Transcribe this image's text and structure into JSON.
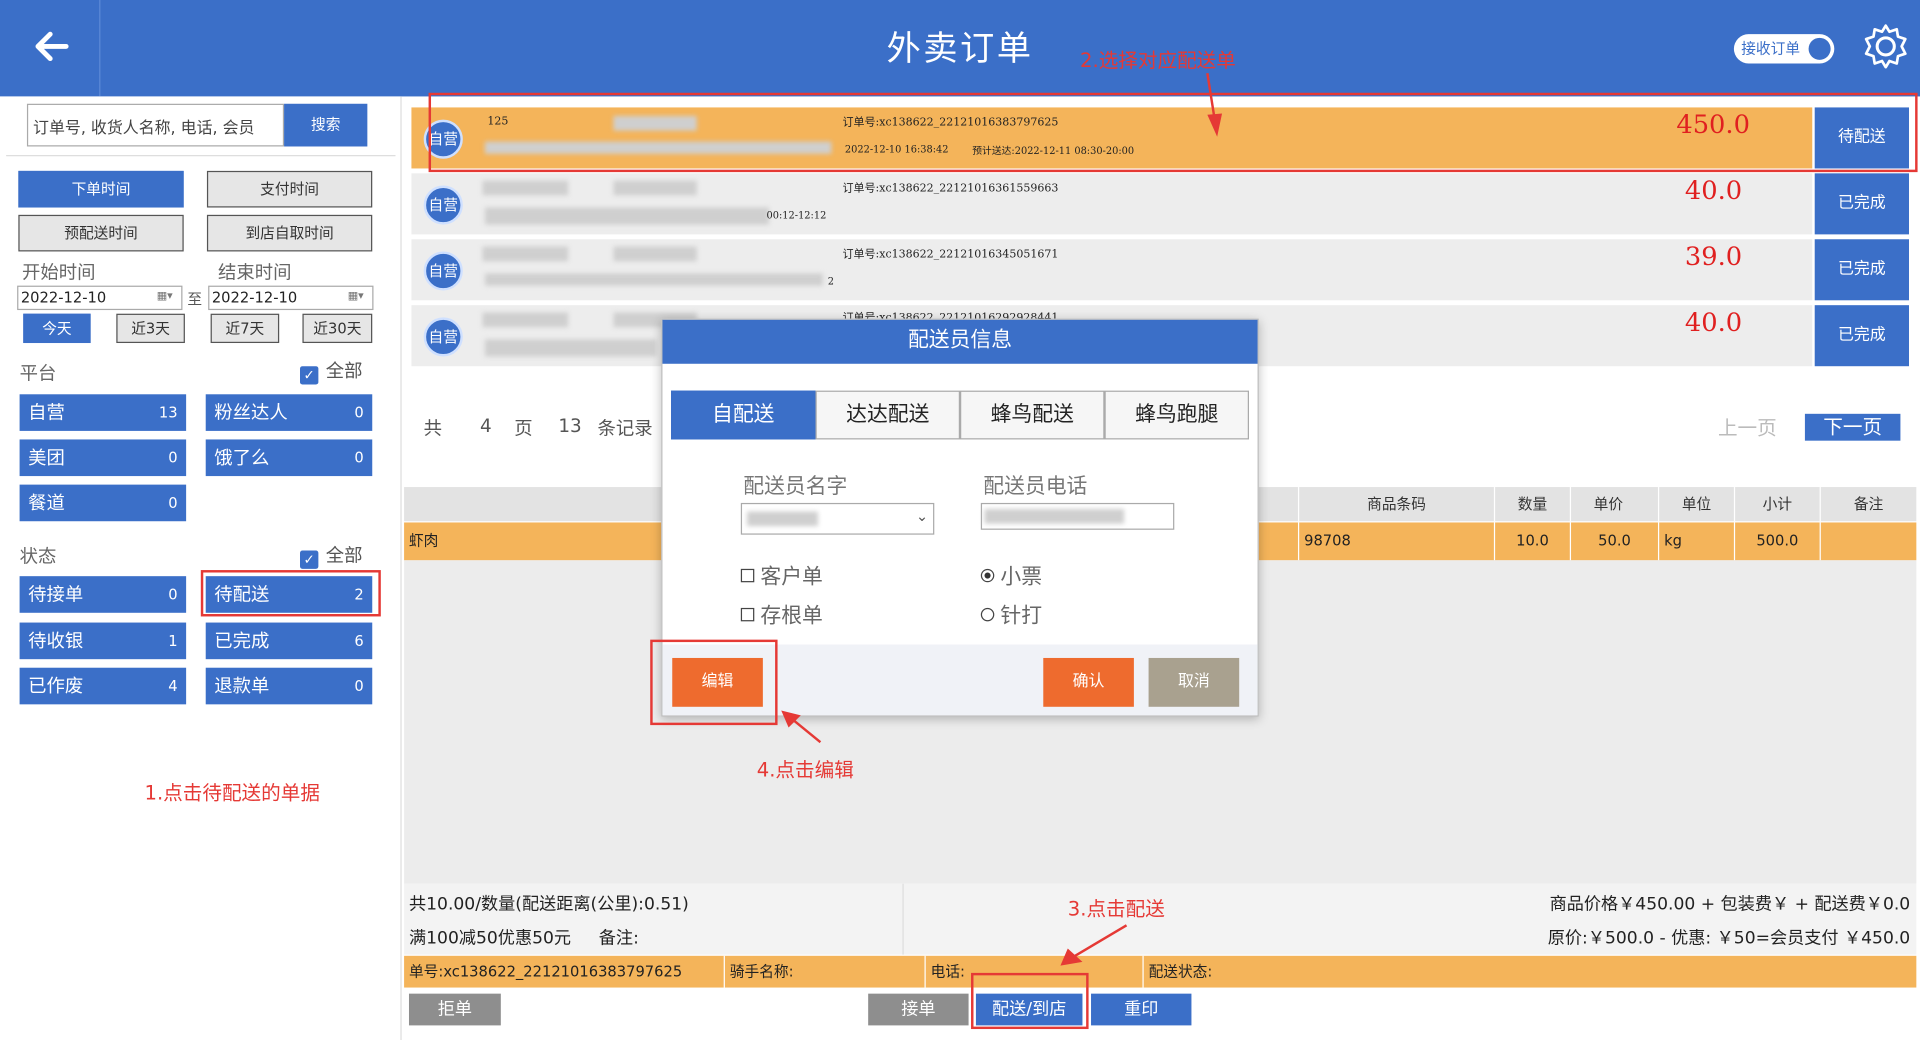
{
  "header": {
    "title": "外卖订单",
    "toggle_label": "接收订单"
  },
  "search": {
    "placeholder": "订单号, 收货人名称, 电话, 会员",
    "button": "搜索"
  },
  "time_filters": {
    "order_time": "下单时间",
    "pay_time": "支付时间",
    "pre_delivery_time": "预配送时间",
    "pickup_time": "到店自取时间"
  },
  "date_range": {
    "start_label": "开始时间",
    "end_label": "结束时间",
    "start": "2022-12-10",
    "end": "2022-12-10",
    "separator": "至",
    "quick": [
      "今天",
      "近3天",
      "近7天",
      "近30天"
    ]
  },
  "platform": {
    "label": "平台",
    "all_label": "全部",
    "items": [
      {
        "name": "自营",
        "count": "13"
      },
      {
        "name": "粉丝达人",
        "count": "0"
      },
      {
        "name": "美团",
        "count": "0"
      },
      {
        "name": "饿了么",
        "count": "0"
      },
      {
        "name": "餐道",
        "count": "0"
      }
    ]
  },
  "status": {
    "label": "状态",
    "all_label": "全部",
    "items": [
      {
        "name": "待接单",
        "count": "0"
      },
      {
        "name": "待配送",
        "count": "2"
      },
      {
        "name": "待收银",
        "count": "1"
      },
      {
        "name": "已完成",
        "count": "6"
      },
      {
        "name": "已作废",
        "count": "4"
      },
      {
        "name": "退款单",
        "count": "0"
      }
    ]
  },
  "orders": [
    {
      "badge": "自营",
      "code": "125",
      "order_no": "订单号:xc138622_22121016383797625",
      "time": "2022-12-10 16:38:42",
      "expected": "预计送达:2022-12-11 08:30-20:00",
      "amount": "450.0",
      "status": "待配送"
    },
    {
      "badge": "自营",
      "order_no": "订单号:xc138622_22121016361559663",
      "time_tail": "00:12-12:12",
      "amount": "40.0",
      "status": "已完成"
    },
    {
      "badge": "自营",
      "order_no": "订单号:xc138622_22121016345051671",
      "time_tail": "2",
      "amount": "39.0",
      "status": "已完成"
    },
    {
      "badge": "自营",
      "order_no": "订单号:xc138622_22121016292928441",
      "amount": "40.0",
      "status": "已完成"
    }
  ],
  "pager": {
    "total_prefix": "共",
    "pages": "4",
    "page_unit": "页",
    "records": "13",
    "record_unit": "条记录",
    "prev": "上一页",
    "next": "下一页"
  },
  "table": {
    "headers": [
      "商品条码",
      "数量",
      "单价",
      "单位",
      "小计",
      "备注"
    ],
    "rows": [
      {
        "name": "虾肉",
        "barcode": "98708",
        "qty": "10.0",
        "price": "50.0",
        "unit": "kg",
        "subtotal": "500.0",
        "note": ""
      }
    ]
  },
  "summary": {
    "left1": "共10.00/数量(配送距离(公里):0.51)",
    "left2": "满100减50优惠50元",
    "note_label": "备注:",
    "right1": "商品价格￥450.00 + 包装费￥ + 配送费￥0.0",
    "right2": "原价:￥500.0 - 优惠: ￥50=会员支付 ￥450.0"
  },
  "info_bar": {
    "order_no": "单号:xc138622_22121016383797625",
    "rider": "骑手名称:",
    "phone": "电话:",
    "delivery_status": "配送状态:"
  },
  "bottom_buttons": {
    "reject": "拒单",
    "accept": "接单",
    "deliver": "配送/到店",
    "reprint": "重印"
  },
  "modal": {
    "title": "配送员信息",
    "tabs": [
      "自配送",
      "达达配送",
      "蜂鸟配送",
      "蜂鸟跑腿"
    ],
    "name_label": "配送员名字",
    "phone_label": "配送员电话",
    "options": {
      "customer": "客户单",
      "stub": "存根单",
      "receipt": "小票",
      "dot": "针打"
    },
    "edit": "编辑",
    "confirm": "确认",
    "cancel": "取消"
  },
  "annotations": {
    "step1": "1.点击待配送的单据",
    "step2": "2.选择对应配送单",
    "step3": "3.点击配送",
    "step4": "4.点击编辑"
  },
  "colors": {
    "primary": "#3b6fc8",
    "highlight": "#f4b45a",
    "price": "#e02020",
    "annotation": "#e53935",
    "edit_btn": "#ee6b2e"
  }
}
